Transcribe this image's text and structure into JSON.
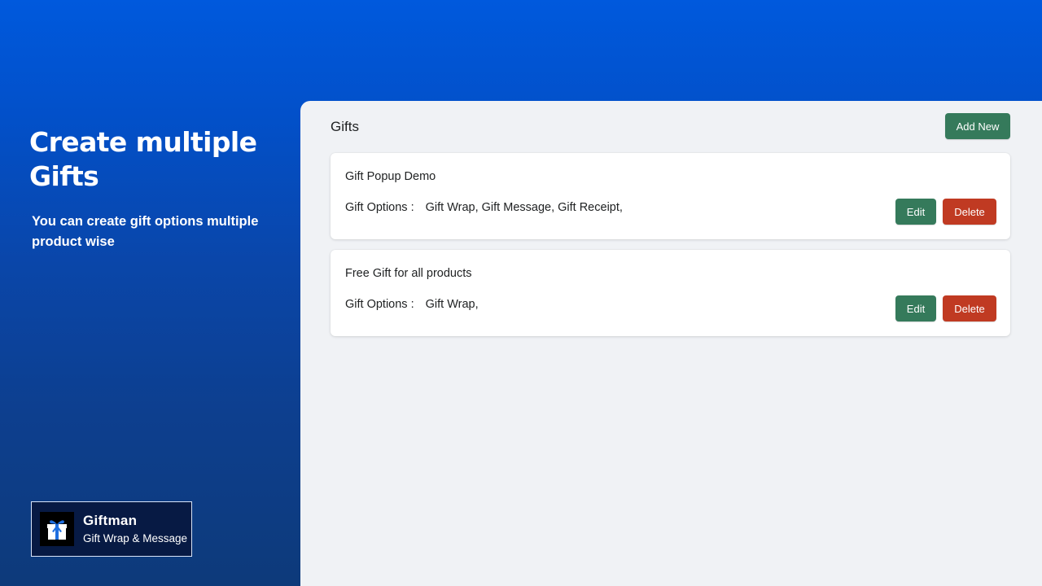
{
  "hero": {
    "heading": "Create multiple Gifts",
    "description": "You can create gift options multiple product wise"
  },
  "brand": {
    "name": "Giftman",
    "tagline": "Gift Wrap & Message",
    "logo_icon": "gift-icon"
  },
  "panel": {
    "title": "Gifts",
    "add_button_label": "Add New"
  },
  "gifts": [
    {
      "title": "Gift Popup Demo",
      "options_label": "Gift Options :",
      "options_value": "Gift Wrap, Gift Message, Gift Receipt,",
      "edit_label": "Edit",
      "delete_label": "Delete"
    },
    {
      "title": "Free Gift for all products",
      "options_label": "Gift Options :",
      "options_value": "Gift Wrap,",
      "edit_label": "Edit",
      "delete_label": "Delete"
    }
  ],
  "colors": {
    "primary_green": "#357a5b",
    "danger_red": "#c03a22",
    "brand_blue": "#0059dd"
  }
}
